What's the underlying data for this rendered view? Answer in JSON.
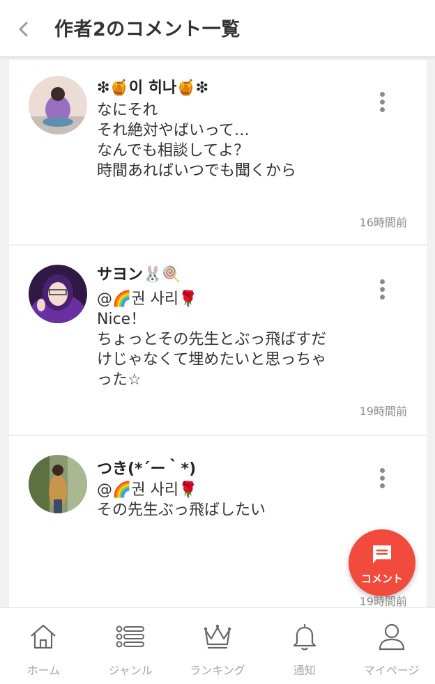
{
  "header": {
    "title": "作者2のコメント一覧"
  },
  "comments": [
    {
      "name": "❇🍯이 히나🍯❇",
      "lines": [
        "なにそれ",
        "それ絶対やばいって…",
        "なんでも相談してよ？",
        "時間あればいつでも聞くから"
      ],
      "time": "16時間前",
      "avatar_colors": [
        "#c7a9d6",
        "#7a4a9c",
        "#e9d8d0"
      ]
    },
    {
      "name": "サヨン🐰🍭",
      "lines": [
        "@🌈권 사리🌹",
        "Nice！",
        "ちょっとその先生とぶっ飛ばすだ",
        "けじゃなくて埋めたいと思っちゃ",
        "った☆"
      ],
      "time": "19時間前",
      "avatar_colors": [
        "#5b2a8a",
        "#3a1a5a",
        "#f0d8d0"
      ]
    },
    {
      "name": "つき(*´ー｀*)",
      "lines": [
        "@🌈권 사리🌹",
        "その先生ぶっ飛ばしたい"
      ],
      "time": "19時間前",
      "avatar_colors": [
        "#6f8a4a",
        "#c89850",
        "#3a4a2a"
      ]
    }
  ],
  "fab": {
    "label": "コメント",
    "color": "#f24a3c"
  },
  "nav": {
    "items": [
      {
        "label": "ホーム",
        "icon": "home-icon"
      },
      {
        "label": "ジャンル",
        "icon": "list-icon"
      },
      {
        "label": "ランキング",
        "icon": "crown-icon"
      },
      {
        "label": "通知",
        "icon": "bell-icon"
      },
      {
        "label": "マイページ",
        "icon": "user-icon"
      }
    ]
  }
}
